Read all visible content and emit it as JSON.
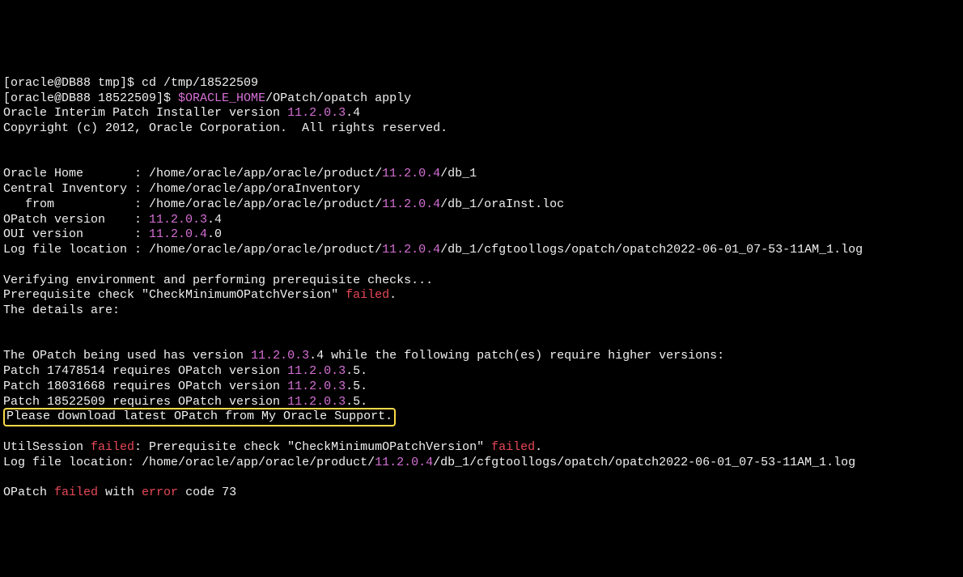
{
  "line1": {
    "prompt1": "[oracle@DB88 tmp]$ ",
    "cmd1": "cd /tmp/18522509"
  },
  "line2": {
    "prompt2": "[oracle@DB88 18522509]$ ",
    "env": "$ORACLE_HOME",
    "cmd2": "/OPatch/opatch apply"
  },
  "line3": {
    "pre": "Oracle Interim Patch Installer version ",
    "ver": "11.2.0.3",
    "post": ".4"
  },
  "line4": "Copyright (c) 2012, Oracle Corporation.  All rights reserved.",
  "line5": {
    "label": "Oracle Home       : ",
    "pre": "/home/oracle/app/oracle/product/",
    "ver": "11.2.0.4",
    "post": "/db_1"
  },
  "line6": {
    "label": "Central Inventory : ",
    "val": "/home/oracle/app/oraInventory"
  },
  "line7": {
    "label": "   from           : ",
    "pre": "/home/oracle/app/oracle/product/",
    "ver": "11.2.0.4",
    "post": "/db_1/oraInst.loc"
  },
  "line8": {
    "label": "OPatch version    : ",
    "ver": "11.2.0.3",
    "post": ".4"
  },
  "line9": {
    "label": "OUI version       : ",
    "ver": "11.2.0.4",
    "post": ".0"
  },
  "line10": {
    "label": "Log file location : ",
    "pre": "/home/oracle/app/oracle/product/",
    "ver": "11.2.0.4",
    "post": "/db_1/cfgtoollogs/opatch/opatch2022-06-01_07-53-11AM_1.log"
  },
  "line11": "Verifying environment and performing prerequisite checks...",
  "line12": {
    "pre": "Prerequisite check \"CheckMinimumOPatchVersion\" ",
    "fail": "failed",
    "post": "."
  },
  "line13": "The details are:",
  "line14": {
    "pre": "The OPatch being used has version ",
    "ver": "11.2.0.3",
    "post": ".4 while the following patch(es) require higher versions: "
  },
  "line15": {
    "pre": "Patch 17478514 requires OPatch version ",
    "ver": "11.2.0.3",
    "post": ".5."
  },
  "line16": {
    "pre": "Patch 18031668 requires OPatch version ",
    "ver": "11.2.0.3",
    "post": ".5."
  },
  "line17": {
    "pre": "Patch 18522509 requires OPatch version ",
    "ver": "11.2.0.3",
    "post": ".5."
  },
  "line18": "Please download latest OPatch from My Oracle Support.",
  "line19": {
    "pre": "UtilSession ",
    "fail": "failed",
    "mid": ": Prerequisite check \"CheckMinimumOPatchVersion\" ",
    "fail2": "failed",
    "post": "."
  },
  "line20": {
    "label": "Log file location: ",
    "pre": "/home/oracle/app/oracle/product/",
    "ver": "11.2.0.4",
    "post": "/db_1/cfgtoollogs/opatch/opatch2022-06-01_07-53-11AM_1.log"
  },
  "line21": {
    "pre": "OPatch ",
    "fail": "failed",
    "mid": " with ",
    "err": "error",
    "post": " code 73"
  }
}
